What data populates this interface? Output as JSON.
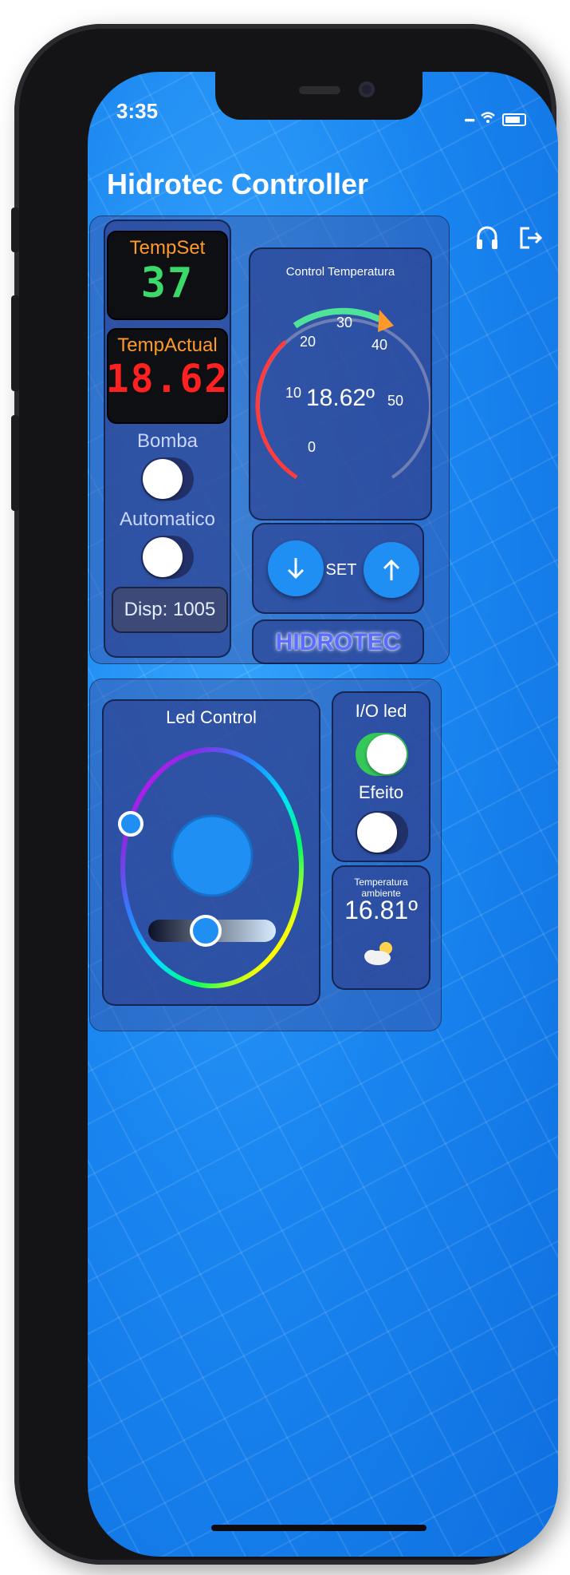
{
  "status": {
    "time": "3:35"
  },
  "header": {
    "title": "Hidrotec Controller",
    "support_icon": "headset-icon",
    "logout_icon": "logout-icon"
  },
  "left_panel": {
    "tempset_label": "TempSet",
    "tempset_value": "37",
    "tempactual_label": "TempActual",
    "tempactual_value": "18.62",
    "bomba_label": "Bomba",
    "bomba_on": false,
    "automatico_label": "Automatico",
    "automatico_on": false,
    "disp_label": "Disp: 1005"
  },
  "gauge": {
    "title": "Control Temperatura",
    "value_text": "18.62º",
    "value": 18.62,
    "setpoint": 37,
    "min": 0,
    "max": 60,
    "ticks": [
      "0",
      "10",
      "20",
      "30",
      "40",
      "50"
    ]
  },
  "set_controls": {
    "down_icon": "arrow-down-icon",
    "set_label": "SET",
    "up_icon": "arrow-up-icon"
  },
  "brand": {
    "logo_text": "HIDROTEC"
  },
  "led": {
    "title": "Led Control",
    "color": "#1f8ff4",
    "brightness": 0.45
  },
  "io": {
    "io_label": "I/O led",
    "io_on": true,
    "efeito_label": "Efeito",
    "efeito_on": false
  },
  "ambient": {
    "title": "Temperatura ambiente",
    "value": "16.81º",
    "weather_icon": "partly-cloudy-icon"
  },
  "colors": {
    "accent": "#1f8ff4",
    "on": "#34c759",
    "led_red": "#ff2020",
    "set_green": "#3cd86a",
    "label_orange": "#ff9a2a"
  }
}
